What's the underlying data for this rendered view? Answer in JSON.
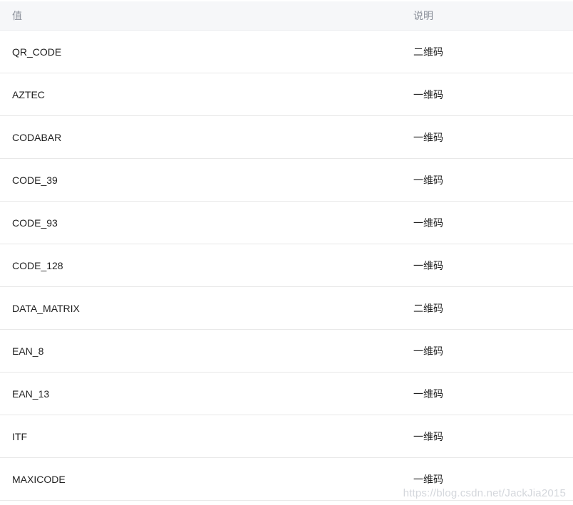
{
  "table": {
    "headers": {
      "value": "值",
      "description": "说明"
    },
    "rows": [
      {
        "value": "QR_CODE",
        "description": "二维码"
      },
      {
        "value": "AZTEC",
        "description": "一维码"
      },
      {
        "value": "CODABAR",
        "description": "一维码"
      },
      {
        "value": "CODE_39",
        "description": "一维码"
      },
      {
        "value": "CODE_93",
        "description": "一维码"
      },
      {
        "value": "CODE_128",
        "description": "一维码"
      },
      {
        "value": "DATA_MATRIX",
        "description": "二维码"
      },
      {
        "value": "EAN_8",
        "description": "一维码"
      },
      {
        "value": "EAN_13",
        "description": "一维码"
      },
      {
        "value": "ITF",
        "description": "一维码"
      },
      {
        "value": "MAXICODE",
        "description": "一维码"
      }
    ]
  },
  "watermark": {
    "text": "https://blog.csdn.net/JackJia2015"
  }
}
